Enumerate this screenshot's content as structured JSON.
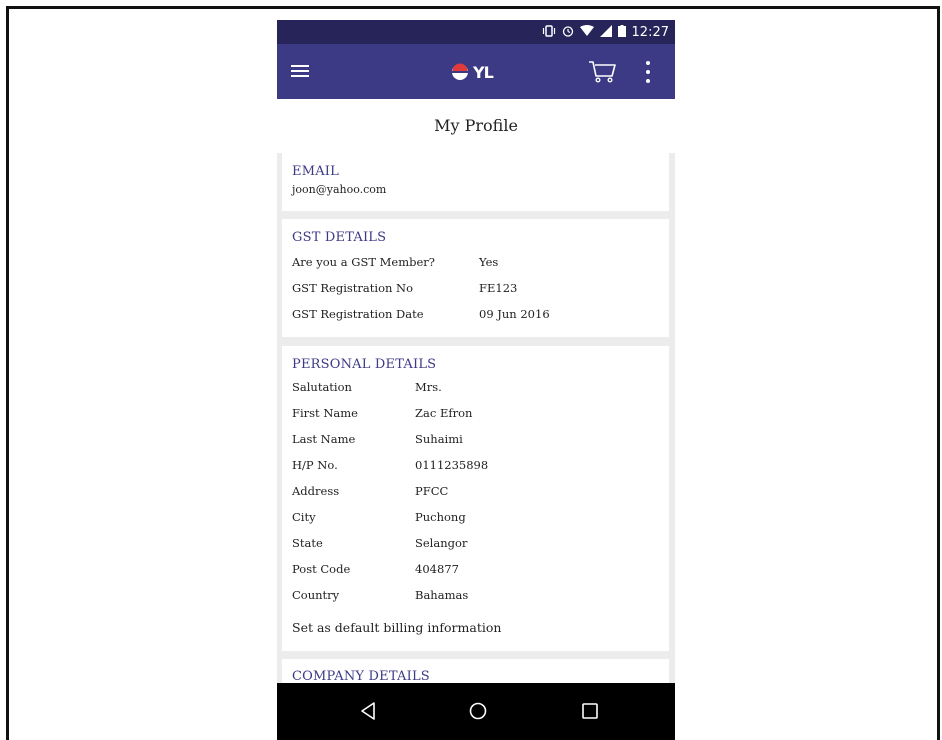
{
  "status_bar": {
    "time": "12:27"
  },
  "app_bar": {
    "logo_text": "YL"
  },
  "page": {
    "title": "My Profile"
  },
  "email": {
    "heading": "EMAIL",
    "value": "joon@yahoo.com"
  },
  "gst": {
    "heading": "GST DETAILS",
    "rows": [
      {
        "label": "Are you a GST Member?",
        "value": "Yes"
      },
      {
        "label": "GST Registration No",
        "value": "FE123"
      },
      {
        "label": "GST Registration Date",
        "value": "09 Jun 2016"
      }
    ]
  },
  "personal": {
    "heading": "PERSONAL DETAILS",
    "rows": [
      {
        "label": "Salutation",
        "value": "Mrs."
      },
      {
        "label": "First Name",
        "value": "Zac Efron"
      },
      {
        "label": "Last Name",
        "value": "Suhaimi"
      },
      {
        "label": "H/P No.",
        "value": "0111235898"
      },
      {
        "label": "Address",
        "value": "PFCC"
      },
      {
        "label": "City",
        "value": "Puchong"
      },
      {
        "label": "State",
        "value": "Selangor"
      },
      {
        "label": "Post Code",
        "value": "404877"
      },
      {
        "label": "Country",
        "value": "Bahamas"
      }
    ],
    "default_billing": "Set as default billing information"
  },
  "company": {
    "heading": "COMPANY DETAILS"
  },
  "colors": {
    "app_bar": "#3c3985",
    "status_bar": "#27245a",
    "heading": "#3c3985"
  }
}
